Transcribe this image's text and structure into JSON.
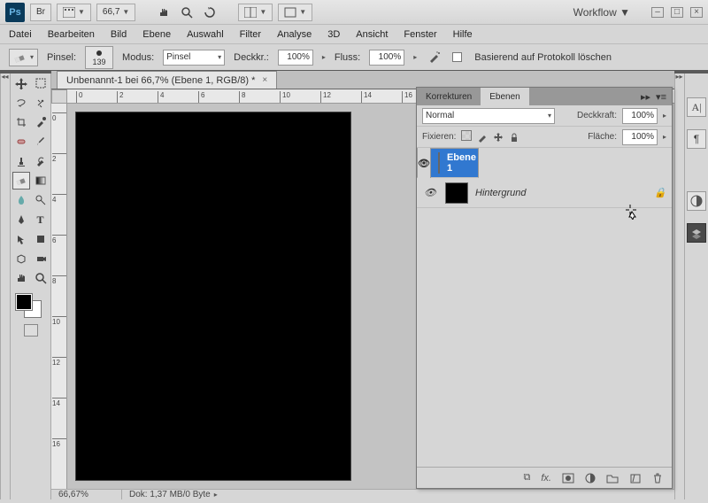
{
  "titlebar": {
    "zoom": "66,7",
    "workflow": "Workflow"
  },
  "menu": [
    "Datei",
    "Bearbeiten",
    "Bild",
    "Ebene",
    "Auswahl",
    "Filter",
    "Analyse",
    "3D",
    "Ansicht",
    "Fenster",
    "Hilfe"
  ],
  "options": {
    "brush_label": "Pinsel:",
    "brush_size": "139",
    "mode_label": "Modus:",
    "mode_value": "Pinsel",
    "opacity_label": "Deckkr.:",
    "opacity_value": "100%",
    "flow_label": "Fluss:",
    "flow_value": "100%",
    "history_label": "Basierend auf Protokoll löschen"
  },
  "doc": {
    "tab": "Unbenannt-1 bei 66,7% (Ebene 1, RGB/8) *"
  },
  "ruler_h": [
    "0",
    "2",
    "4",
    "6",
    "8",
    "10",
    "12",
    "14",
    "16"
  ],
  "ruler_v": [
    "0",
    "2",
    "4",
    "6",
    "8",
    "10",
    "12",
    "14",
    "16"
  ],
  "status": {
    "zoom": "66,67%",
    "doc": "Dok: 1,37 MB/0 Byte"
  },
  "layerspanel": {
    "tabs": [
      "Korrekturen",
      "Ebenen"
    ],
    "blend": "Normal",
    "opacity_label": "Deckkraft:",
    "opacity": "100%",
    "lock_label": "Fixieren:",
    "fill_label": "Fläche:",
    "fill": "100%",
    "layers": [
      {
        "name": "Ebene 1",
        "selected": true,
        "bg": false
      },
      {
        "name": "Hintergrund",
        "selected": false,
        "bg": true
      }
    ]
  }
}
